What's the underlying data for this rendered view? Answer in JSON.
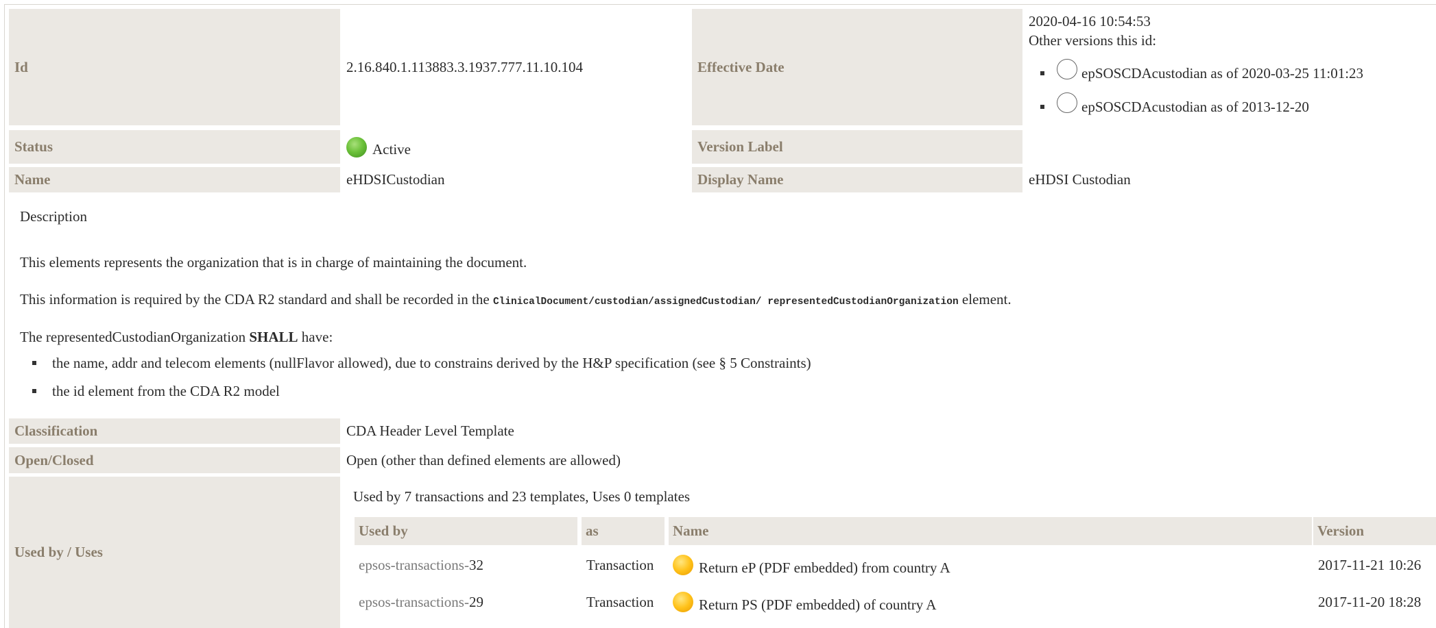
{
  "header": {
    "id_label": "Id",
    "id_value": "2.16.840.1.113883.3.1937.777.11.10.104",
    "effective_date_label": "Effective Date",
    "effective_date_value": "2020-04-16 10:54:53",
    "other_versions_label": "Other versions this id:",
    "other_versions": [
      {
        "label": "epSOSCDAcustodian as of 2020-03-25 11:01:23"
      },
      {
        "label": "epSOSCDAcustodian as of 2013-12-20"
      }
    ],
    "status_label": "Status",
    "status_value": "Active",
    "status_color": "#6cc13a",
    "version_label_label": "Version Label",
    "version_label_value": "",
    "name_label": "Name",
    "name_value": "eHDSICustodian",
    "display_name_label": "Display Name",
    "display_name_value": "eHDSI Custodian"
  },
  "description": {
    "heading": "Description",
    "para1": "This elements represents the organization that is in charge of maintaining the document.",
    "para2_prefix": "This information is required by the CDA R2 standard and shall be recorded in the ",
    "para2_code": "ClinicalDocument/custodian/assignedCustodian/ representedCustodianOrganization",
    "para2_suffix": " element.",
    "para3_prefix": "The representedCustodianOrganization ",
    "para3_bold": "SHALL",
    "para3_suffix": " have:",
    "bullets": [
      "the name, addr and telecom elements (nullFlavor allowed), due to constrains derived by the H&P specification (see § 5 Constraints)",
      "the id element from the CDA R2 model"
    ]
  },
  "details": {
    "classification_label": "Classification",
    "classification_value": "CDA Header Level Template",
    "open_closed_label": "Open/Closed",
    "open_closed_value": "Open (other than defined elements are allowed)",
    "used_by_label": "Used by / Uses",
    "used_by_summary": "Used by 7 transactions and 23 templates, Uses 0 templates"
  },
  "usage_table": {
    "columns": [
      "Used by",
      "as",
      "Name",
      "Version"
    ],
    "rows": [
      {
        "used_by_prefix": "epsos-transactions-",
        "used_by_num": "32",
        "as": "Transaction",
        "name": "Return eP (PDF embedded) from country A",
        "version": "2017-11-21 10:26",
        "status_color": "#ffc21a"
      },
      {
        "used_by_prefix": "epsos-transactions-",
        "used_by_num": "29",
        "as": "Transaction",
        "name": "Return PS (PDF embedded) of country A",
        "version": "2017-11-20 18:28",
        "status_color": "#ffc21a"
      }
    ]
  },
  "colors": {
    "label_bg": "#ebe8e3",
    "label_fg": "#8a7e6c"
  }
}
